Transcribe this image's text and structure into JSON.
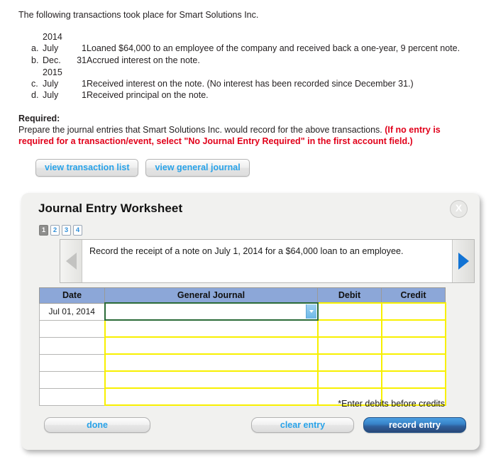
{
  "problem": {
    "intro": "The following transactions took place for Smart Solutions Inc.",
    "year_1": "2014",
    "year_2": "2015",
    "transactions": [
      {
        "letter": "a.",
        "month": "July",
        "day": "1",
        "desc": "Loaned $64,000 to an employee of the company and received back a one-year, 9 percent note."
      },
      {
        "letter": "b.",
        "month": "Dec.",
        "day": "31",
        "desc": "Accrued interest on the note."
      },
      {
        "letter": "c.",
        "month": "July",
        "day": "1",
        "desc": "Received interest on the note. (No interest has been recorded since December 31.)"
      },
      {
        "letter": "d.",
        "month": "July",
        "day": "1",
        "desc": "Received principal on the note."
      }
    ]
  },
  "required": {
    "heading": "Required:",
    "text_black": "Prepare the journal entries that Smart Solutions Inc. would record for the above transactions.",
    "text_red": "(If no entry is required for a transaction/event, select \"No Journal Entry Required\" in the first account field.)"
  },
  "view_buttons": {
    "transaction_list": "view transaction list",
    "general_journal": "view general journal"
  },
  "worksheet": {
    "title": "Journal Entry Worksheet",
    "close_label": "X",
    "steps": [
      "1",
      "2",
      "3",
      "4"
    ],
    "active_step": "1",
    "prev_arrow": "prev-arrow",
    "next_arrow": "next-arrow",
    "instruction": "Record the receipt of a note on July 1, 2014 for a $64,000 loan to an employee.",
    "table": {
      "headers": [
        "Date",
        "General Journal",
        "Debit",
        "Credit"
      ],
      "rows": [
        {
          "date": "Jul 01, 2014",
          "account": "",
          "debit": "",
          "credit": ""
        },
        {
          "date": "",
          "account": "",
          "debit": "",
          "credit": ""
        },
        {
          "date": "",
          "account": "",
          "debit": "",
          "credit": ""
        },
        {
          "date": "",
          "account": "",
          "debit": "",
          "credit": ""
        },
        {
          "date": "",
          "account": "",
          "debit": "",
          "credit": ""
        },
        {
          "date": "",
          "account": "",
          "debit": "",
          "credit": ""
        }
      ]
    },
    "note": "*Enter debits before credits",
    "buttons": {
      "done": "done",
      "clear_entry": "clear entry",
      "record_entry": "record entry"
    }
  },
  "colors": {
    "link_blue": "#28a2e8",
    "required_red": "#e1001a",
    "table_header_blue": "#8ca7d8",
    "field_yellow": "#f8f000",
    "field_focus_green": "#2b6b38",
    "record_button_blue": "#3884c9"
  }
}
